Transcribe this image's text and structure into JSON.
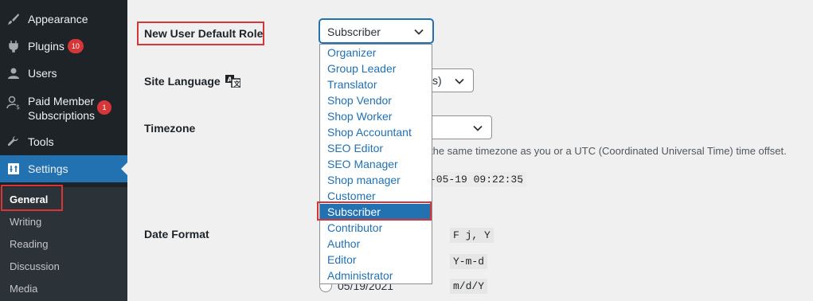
{
  "sidebar": {
    "items": [
      {
        "label": "Appearance",
        "icon": "paintbrush-icon"
      },
      {
        "label": "Plugins",
        "badge": "10",
        "icon": "plug-icon"
      },
      {
        "label": "Users",
        "icon": "users-icon"
      },
      {
        "label": "Paid Member Subscriptions",
        "badge": "1",
        "icon": "member-dollar-icon"
      },
      {
        "label": "Tools",
        "icon": "wrench-icon"
      },
      {
        "label": "Settings",
        "icon": "settings-icon"
      }
    ],
    "submenu": [
      "General",
      "Writing",
      "Reading",
      "Discussion",
      "Media"
    ]
  },
  "form": {
    "default_role_label": "New User Default Role",
    "default_role_value": "Subscriber",
    "site_language_label": "Site Language",
    "site_language_partial": "s)",
    "timezone_label": "Timezone",
    "timezone_help": "the same timezone as you or a UTC (Coordinated Universal Time) time offset.",
    "universal_time_partial": "-05-19 09:22:35",
    "universal_time_period": ".",
    "date_format_label": "Date Format",
    "date_format_codes": [
      "F j, Y",
      "Y-m-d",
      "m/d/Y"
    ],
    "date_format_example_partial": "05/19/2021"
  },
  "dropdown": {
    "options": [
      "Organizer",
      "Group Leader",
      "Translator",
      "Shop Vendor",
      "Shop Worker",
      "Shop Accountant",
      "SEO Editor",
      "SEO Manager",
      "Shop manager",
      "Customer",
      "Subscriber",
      "Contributor",
      "Author",
      "Editor",
      "Administrator"
    ],
    "selected": "Subscriber"
  },
  "colors": {
    "sidebar_bg": "#1d2327",
    "accent": "#2271b1",
    "highlight_box": "#d63638"
  }
}
